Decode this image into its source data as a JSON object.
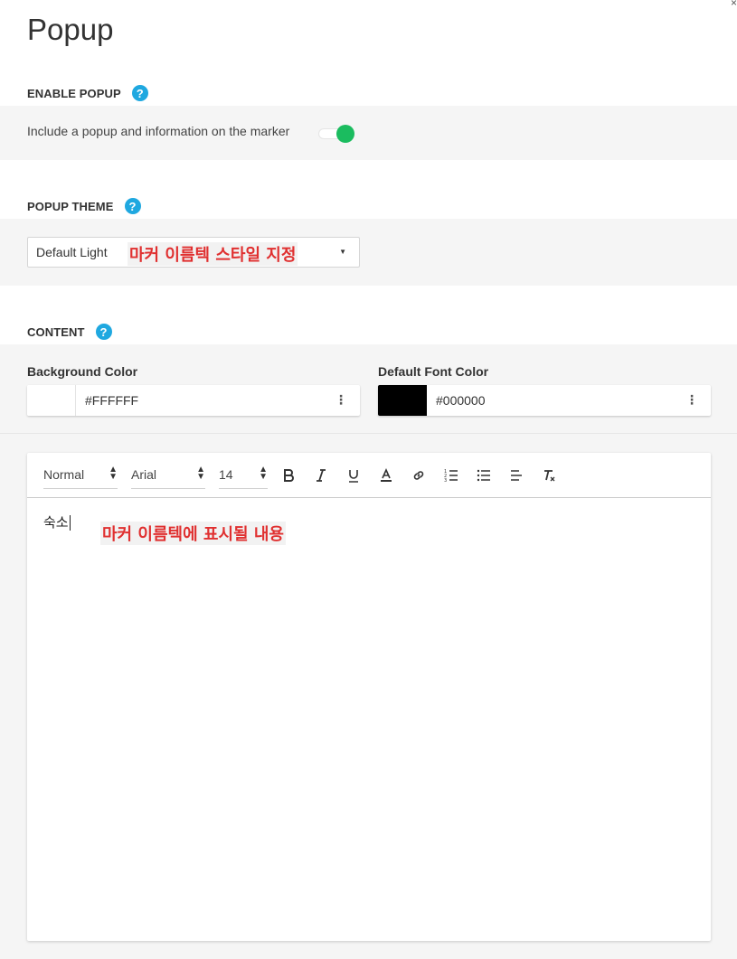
{
  "modal": {
    "title": "Popup",
    "close_glyph": "×"
  },
  "enable_popup": {
    "label": "ENABLE POPUP",
    "help": "?",
    "toggle_text": "Include a popup and information on the marker",
    "toggle_on": true,
    "toggle_color": "#1bbc5f"
  },
  "popup_theme": {
    "label": "POPUP THEME",
    "help": "?",
    "selected": "Default Light",
    "annotation": "마커 이름텍 스타일 지정"
  },
  "content": {
    "label": "CONTENT",
    "help": "?",
    "background_color": {
      "label": "Background Color",
      "value": "#FFFFFF"
    },
    "font_color": {
      "label": "Default Font Color",
      "value": "#000000"
    }
  },
  "editor": {
    "toolbar": {
      "format": "Normal",
      "font": "Arial",
      "size": "14",
      "buttons": [
        "bold-icon",
        "italic-icon",
        "underline-icon",
        "text-color-icon",
        "link-icon",
        "ordered-list-icon",
        "bullet-list-icon",
        "align-left-icon",
        "clear-format-icon"
      ]
    },
    "body_text": "숙소",
    "annotation": "마커 이름텍에 표시될 내용"
  },
  "colors": {
    "accent": "#1fa8e0",
    "annotation": "#e03030",
    "band": "#f5f5f5"
  }
}
